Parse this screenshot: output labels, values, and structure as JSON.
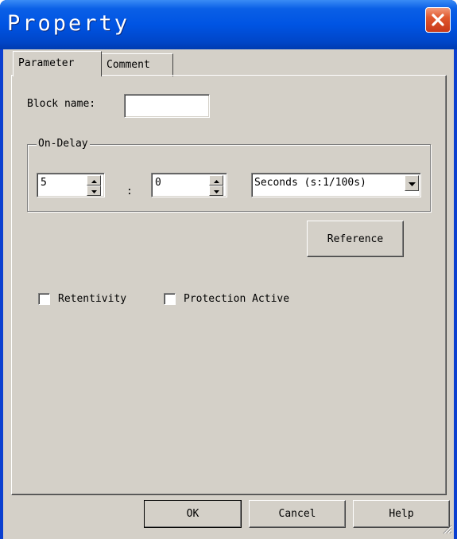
{
  "window": {
    "title": "Property",
    "close_icon": "close-x-icon",
    "accent": "#0054e3",
    "close_color": "#e0582e"
  },
  "tabs": [
    {
      "label": "Parameter",
      "active": true
    },
    {
      "label": "Comment",
      "active": false
    }
  ],
  "parameter": {
    "block_name_label": "Block name:",
    "block_name_value": "",
    "on_delay": {
      "group_label": "On-Delay",
      "first_value": "5",
      "separator": ":",
      "second_value": "0",
      "unit_selected": "Seconds (s:1/100s)"
    },
    "reference_label": "Reference",
    "retentivity_label": "Retentivity",
    "retentivity_checked": false,
    "protection_label": "Protection Active",
    "protection_checked": false
  },
  "buttons": {
    "ok": "OK",
    "cancel": "Cancel",
    "help": "Help"
  }
}
